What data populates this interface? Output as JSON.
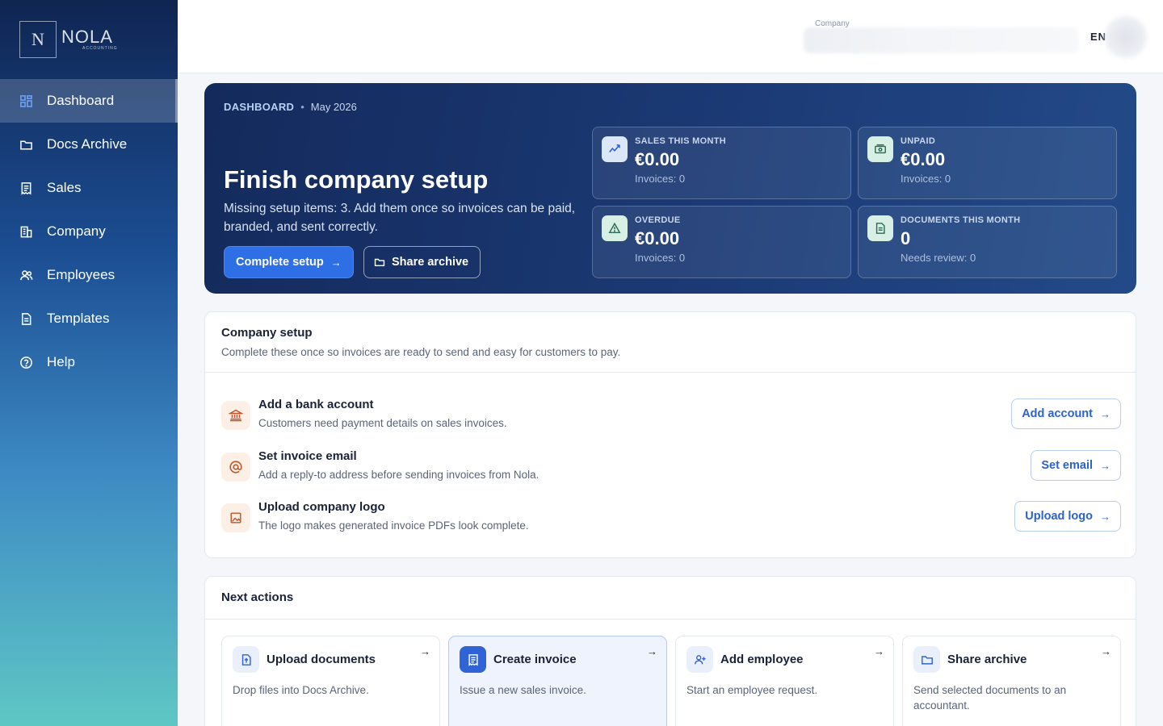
{
  "brand": {
    "logo_letter": "N",
    "logo_name": "NOLA",
    "logo_sub": "ACCOUNTING"
  },
  "sidebar": {
    "items": [
      {
        "label": "Dashboard",
        "icon": "dashboard-icon",
        "active": true
      },
      {
        "label": "Docs Archive",
        "icon": "folder-icon"
      },
      {
        "label": "Sales",
        "icon": "receipt-icon"
      },
      {
        "label": "Company",
        "icon": "building-icon"
      },
      {
        "label": "Employees",
        "icon": "users-icon"
      },
      {
        "label": "Templates",
        "icon": "document-icon"
      },
      {
        "label": "Help",
        "icon": "help-icon"
      }
    ]
  },
  "topbar": {
    "company_label": "Company",
    "language": "EN"
  },
  "hero": {
    "breadcrumb_section": "DASHBOARD",
    "breadcrumb_date": "May 2026",
    "title": "Finish company setup",
    "description": "Missing setup items: 3. Add them once so invoices can be paid, branded, and sent correctly.",
    "primary_button": "Complete setup",
    "secondary_button": "Share archive",
    "stats": [
      {
        "label": "SALES THIS MONTH",
        "value": "€0.00",
        "sub": "Invoices: 0",
        "icon": "sparkline-icon"
      },
      {
        "label": "UNPAID",
        "value": "€0.00",
        "sub": "Invoices: 0",
        "icon": "banknote-icon"
      },
      {
        "label": "OVERDUE",
        "value": "€0.00",
        "sub": "Invoices: 0",
        "icon": "warning-icon"
      },
      {
        "label": "DOCUMENTS THIS MONTH",
        "value": "0",
        "sub": "Needs review: 0",
        "icon": "document-icon"
      }
    ]
  },
  "setup": {
    "title": "Company setup",
    "subtitle": "Complete these once so invoices are ready to send and easy for customers to pay.",
    "items": [
      {
        "title": "Add a bank account",
        "desc": "Customers need payment details on sales invoices.",
        "button": "Add account",
        "icon": "bank-icon"
      },
      {
        "title": "Set invoice email",
        "desc": "Add a reply-to address before sending invoices from Nola.",
        "button": "Set email",
        "icon": "at-sign-icon"
      },
      {
        "title": "Upload company logo",
        "desc": "The logo makes generated invoice PDFs look complete.",
        "button": "Upload logo",
        "icon": "image-icon"
      }
    ]
  },
  "next_actions": {
    "title": "Next actions",
    "items": [
      {
        "title": "Upload documents",
        "desc": "Drop files into Docs Archive.",
        "icon": "file-upload-icon"
      },
      {
        "title": "Create invoice",
        "desc": "Issue a new sales invoice.",
        "icon": "invoice-icon"
      },
      {
        "title": "Add employee",
        "desc": "Start an employee request.",
        "icon": "user-plus-icon"
      },
      {
        "title": "Share archive",
        "desc": "Send selected documents to an accountant.",
        "icon": "folder-icon"
      }
    ]
  },
  "colors": {
    "primary": "#2f6fe6",
    "hero_bg": "#1b3a75",
    "link_text": "#2c62c9",
    "setup_icon_accent": "#c0562a"
  }
}
